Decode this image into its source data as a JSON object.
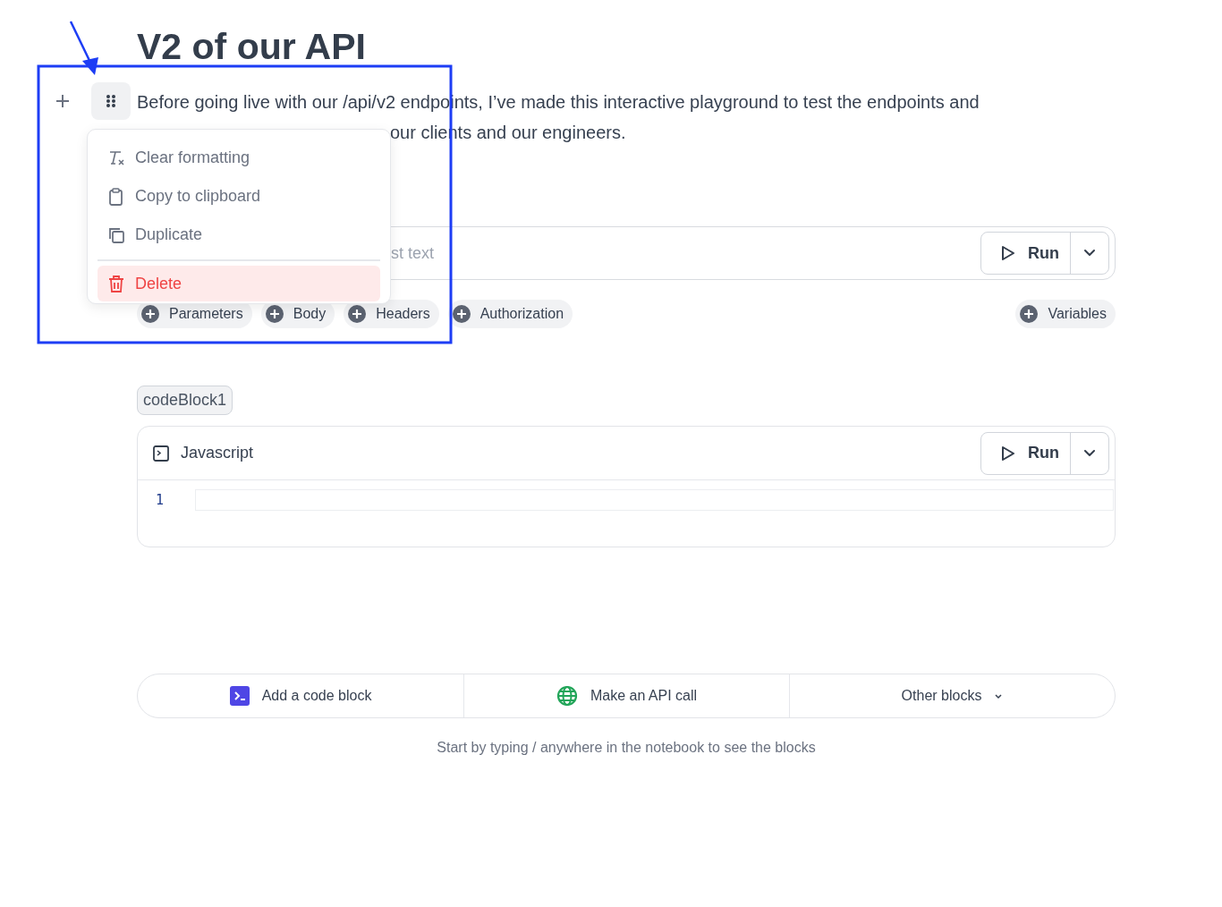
{
  "title": "V2 of our API",
  "paragraph": {
    "line_1": "Before going live with our /api/v2 endpoints, I’ve made this interactive playground to test the endpoints and",
    "line_2_visible": "our clients and our engineers."
  },
  "context_menu": {
    "items": [
      {
        "kind": "clear-format",
        "label": "Clear formatting",
        "danger": false,
        "selected": false
      },
      {
        "kind": "copy",
        "label": "Copy to clipboard",
        "danger": false,
        "selected": false
      },
      {
        "kind": "duplicate",
        "label": "Duplicate",
        "danger": false,
        "selected": false
      },
      {
        "kind": "delete",
        "label": "Delete",
        "danger": true,
        "selected": true
      }
    ]
  },
  "api_block": {
    "placeholder": "st text",
    "run": "Run",
    "chips": [
      {
        "label": "Parameters"
      },
      {
        "label": "Body"
      },
      {
        "label": "Headers"
      },
      {
        "label": "Authorization"
      }
    ],
    "variables": "Variables"
  },
  "code_block": {
    "name": "codeBlock1",
    "language": "Javascript",
    "run": "Run",
    "line_numbers": [
      "1"
    ]
  },
  "add_bar": {
    "items": [
      {
        "kind": "code",
        "label": "Add a code block"
      },
      {
        "kind": "api",
        "label": "Make an API call"
      },
      {
        "kind": "more",
        "label": "Other blocks"
      }
    ]
  },
  "hint": "Start by typing / anywhere in the notebook to see the blocks",
  "annotation": {
    "visible": true
  }
}
